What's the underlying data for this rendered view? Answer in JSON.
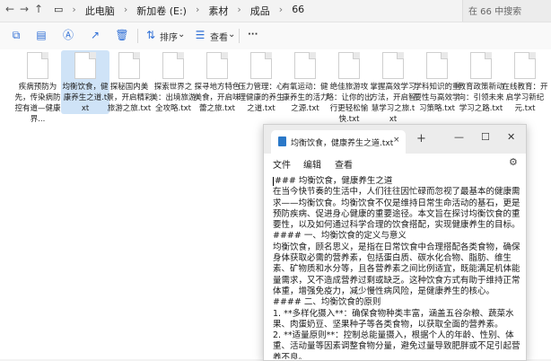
{
  "explorer": {
    "nav_back": "←",
    "nav_forward": "→",
    "nav_up": "↑",
    "breadcrumbs": [
      "此电脑",
      "新加卷 (E:)",
      "素材",
      "成品",
      "66"
    ],
    "search_placeholder": "在 66 中搜索",
    "toolbar": {
      "sort_label": "排序",
      "view_label": "查看",
      "more_label": "···"
    },
    "files": [
      {
        "name": "疾病预防为先，传染病防控有道—健康界..."
      },
      {
        "name": "均衡饮食，健康养生之道.txt",
        "selected": true
      },
      {
        "name": "探秘国内美景，开启精彩旅游之旅.txt"
      },
      {
        "name": "探索世界之美：出境旅游全攻略.txt"
      },
      {
        "name": "探寻地方特色美食，开启味蕾之旅.txt"
      },
      {
        "name": "压力管理：心理健康的养生之道.txt"
      },
      {
        "name": "有氧运动：健康养生的活力之源.txt"
      },
      {
        "name": "绝佳旅游攻略：让你的出行更轻松愉快.txt"
      },
      {
        "name": "掌握高效学习方法，开启智慧学习之旅.txt"
      },
      {
        "name": "学科知识的重要性与高效学习策略.txt"
      },
      {
        "name": "教育政策新动向：引领未来学习之路.txt"
      },
      {
        "name": "在线教育：开启学习新纪元.txt"
      }
    ]
  },
  "notepad": {
    "tab_title": "均衡饮食，健康养生之道.txt",
    "tab_close": "×",
    "new_tab": "+",
    "win_min": "—",
    "win_max": "☐",
    "win_close": "✕",
    "menu": {
      "file": "文件",
      "edit": "编辑",
      "view": "查看"
    },
    "lines": [
      "### 均衡饮食，健康养生之道",
      "在当今快节奏的生活中，人们往往因忙碌而忽视了最基本的健康需求——均衡饮食。均衡饮食不仅是维持日常生命活动的基石，更是预防疾病、促进身心健康的重要途径。本文旨在探讨均衡饮食的重要性，以及如何通过科学合理的饮食搭配，实现健康养生的目标。",
      "#### 一、均衡饮食的定义与意义",
      "均衡饮食，顾名思义，是指在日常饮食中合理搭配各类食物，确保身体获取必需的营养素，包括蛋白质、碳水化合物、脂肪、维生素、矿物质和水分等，且各营养素之间比例适宜，既能满足机体能量需求，又不造成营养过剩或缺乏。这种饮食方式有助于维持正常体重，增强免疫力，减少慢性病风险，是健康养生的核心。",
      "#### 二、均衡饮食的原则",
      "1. **多样化摄入**：确保食物种类丰富，涵盖五谷杂粮、蔬菜水果、肉蛋奶豆、坚果种子等各类食物，以获取全面的营养素。",
      "2. **适量原则**：控制总能量摄入，根据个人的年龄、性别、体重、活动量等因素调整食物分量，避免过量导致肥胖或不足引起营养不良。"
    ]
  },
  "colors": {
    "accent": "#2f6fd6",
    "selection": "#cfe3f7",
    "notepad_icon": "#2a78c8"
  },
  "icons": [
    "back-arrow-icon",
    "forward-arrow-icon",
    "up-arrow-icon",
    "computer-icon",
    "copy-icon",
    "paste-icon",
    "rename-icon",
    "share-icon",
    "delete-icon",
    "sort-icon",
    "view-icon",
    "document-icon",
    "notepad-icon",
    "gear-icon"
  ]
}
